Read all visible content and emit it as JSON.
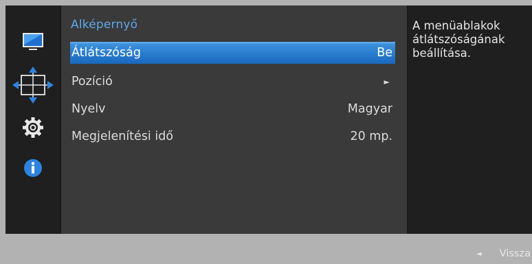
{
  "menu": {
    "title": "Alképernyő",
    "items": [
      {
        "label": "Átlátszóság",
        "value": "Be",
        "selected": true
      },
      {
        "label": "Pozíció",
        "value": "",
        "arrow": "►"
      },
      {
        "label": "Nyelv",
        "value": "Magyar"
      },
      {
        "label": "Megjelenítési idő",
        "value": "20 mp."
      }
    ]
  },
  "sidebar": {
    "icons": [
      "monitor-icon",
      "position-arrows-icon",
      "gear-icon",
      "info-icon"
    ],
    "active": "position-arrows-icon"
  },
  "help": {
    "text": "A menüablakok átlátszóságának beállítása."
  },
  "footer": {
    "back_label": "Vissza",
    "back_glyph": "◄"
  },
  "colors": {
    "accent": "#1a6bc0",
    "title": "#5fa8ea",
    "panel": "#3a3a3a",
    "background": "#1f1f1f",
    "footer": "#b2b2b2"
  }
}
